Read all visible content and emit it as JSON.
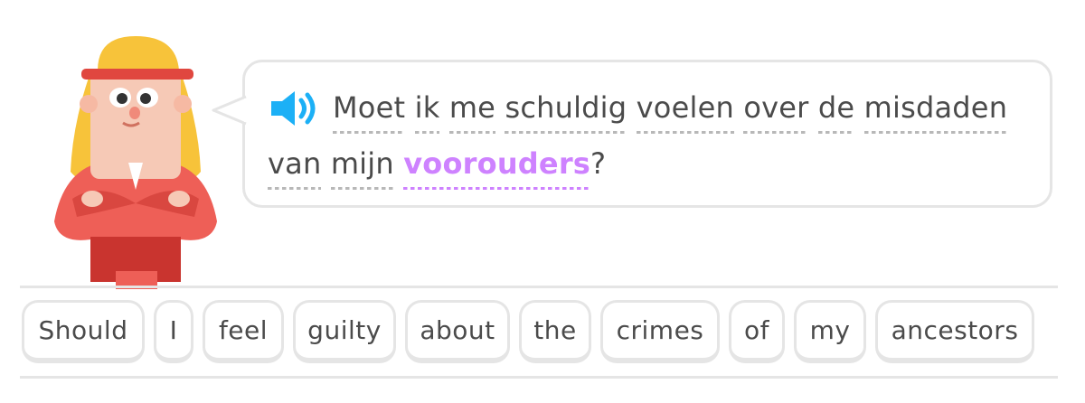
{
  "prompt": {
    "words_line1": [
      "Moet",
      "ik",
      "me",
      "schuldig",
      "voelen",
      "over",
      "de",
      "misdaden"
    ],
    "words_line2": [
      "van",
      "mijn"
    ],
    "highlighted_word": "voorouders",
    "end_punctuation": "?"
  },
  "word_bank": [
    "Should",
    "I",
    "feel",
    "guilty",
    "about",
    "the",
    "crimes",
    "of",
    "my",
    "ancestors"
  ],
  "colors": {
    "highlight": "#ce82ff",
    "speaker": "#1cb0f6",
    "border": "#e5e5e5",
    "text": "#4b4b4b"
  },
  "icons": {
    "speaker": "speaker-icon"
  }
}
